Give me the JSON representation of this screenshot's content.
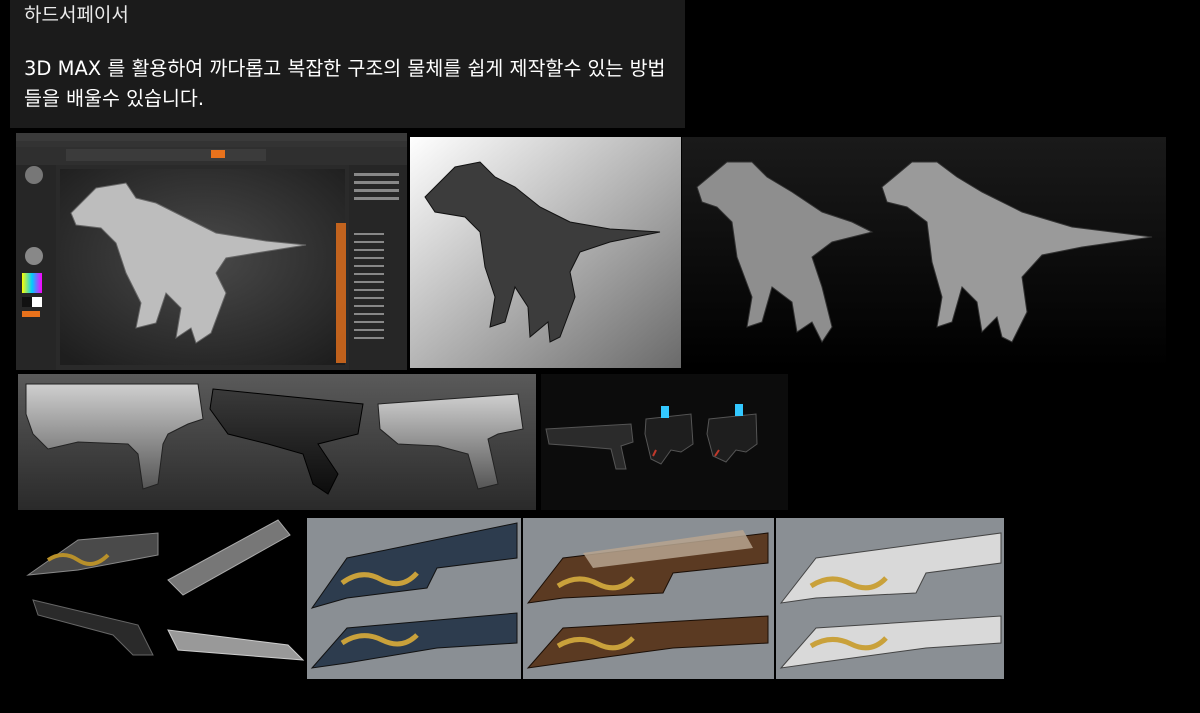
{
  "header": {
    "title": "하드서페이서",
    "description": "3D MAX 를 활용하여 까다롭고 복잡한 구조의 물체를 쉽게 제작할수 있는 방법들을 배울수 있습니다."
  },
  "gallery": {
    "rows": [
      {
        "items": [
          "zbrush-raptor-screenshot",
          "raptor-render-light",
          "raptor-render-dark"
        ]
      },
      {
        "items": [
          "pistol-renders-grey",
          "pistol-renders-dark"
        ]
      },
      {
        "items": [
          "rifle-renders-black",
          "rifle-render-blue",
          "rifle-render-wood",
          "rifle-render-white"
        ]
      }
    ]
  },
  "colors": {
    "background": "#000000",
    "text_panel": "#1b1b1b",
    "zbrush_accent": "#e8721c"
  }
}
